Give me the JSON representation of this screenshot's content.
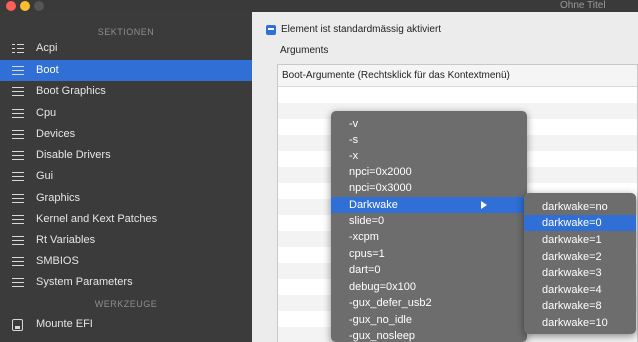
{
  "window": {
    "title": "Ohne Titel"
  },
  "sidebar": {
    "section_sektionen": "SEKTIONEN",
    "section_werkzeuge": "WERKZEUGE",
    "items": [
      {
        "label": "Acpi",
        "icon": "list-icon"
      },
      {
        "label": "Boot",
        "icon": "list-icon"
      },
      {
        "label": "Boot Graphics",
        "icon": "list-icon"
      },
      {
        "label": "Cpu",
        "icon": "list-icon"
      },
      {
        "label": "Devices",
        "icon": "list-icon"
      },
      {
        "label": "Disable Drivers",
        "icon": "list-icon"
      },
      {
        "label": "Gui",
        "icon": "list-icon"
      },
      {
        "label": "Graphics",
        "icon": "list-icon"
      },
      {
        "label": "Kernel and Kext Patches",
        "icon": "list-icon"
      },
      {
        "label": "Rt Variables",
        "icon": "list-icon"
      },
      {
        "label": "SMBIOS",
        "icon": "list-icon"
      },
      {
        "label": "System Parameters",
        "icon": "list-icon"
      }
    ],
    "selected": "Boot",
    "tools": [
      {
        "label": "Mounte EFI",
        "icon": "disk-icon"
      }
    ]
  },
  "main": {
    "checkbox_label": "Element ist standardmässig aktiviert",
    "checkbox_checked": true,
    "group_label": "Arguments",
    "table_header": "Boot-Argumente (Rechtsklick für das Kontextmenü)"
  },
  "context_menu": {
    "items": [
      "-v",
      "-s",
      "-x",
      "npci=0x2000",
      "npci=0x3000",
      "Darkwake",
      "slide=0",
      "-xcpm",
      "cpus=1",
      "dart=0",
      "debug=0x100",
      "-gux_defer_usb2",
      "-gux_no_idle",
      "-gux_nosleep"
    ],
    "highlighted": "Darkwake"
  },
  "submenu": {
    "items": [
      "darkwake=no",
      "darkwake=0",
      "darkwake=1",
      "darkwake=2",
      "darkwake=3",
      "darkwake=4",
      "darkwake=8",
      "darkwake=10"
    ],
    "highlighted": "darkwake=0"
  },
  "colors": {
    "accent": "#2f6fd6",
    "sidebar": "#3b3b3b",
    "menu": "#6d6d6d"
  }
}
